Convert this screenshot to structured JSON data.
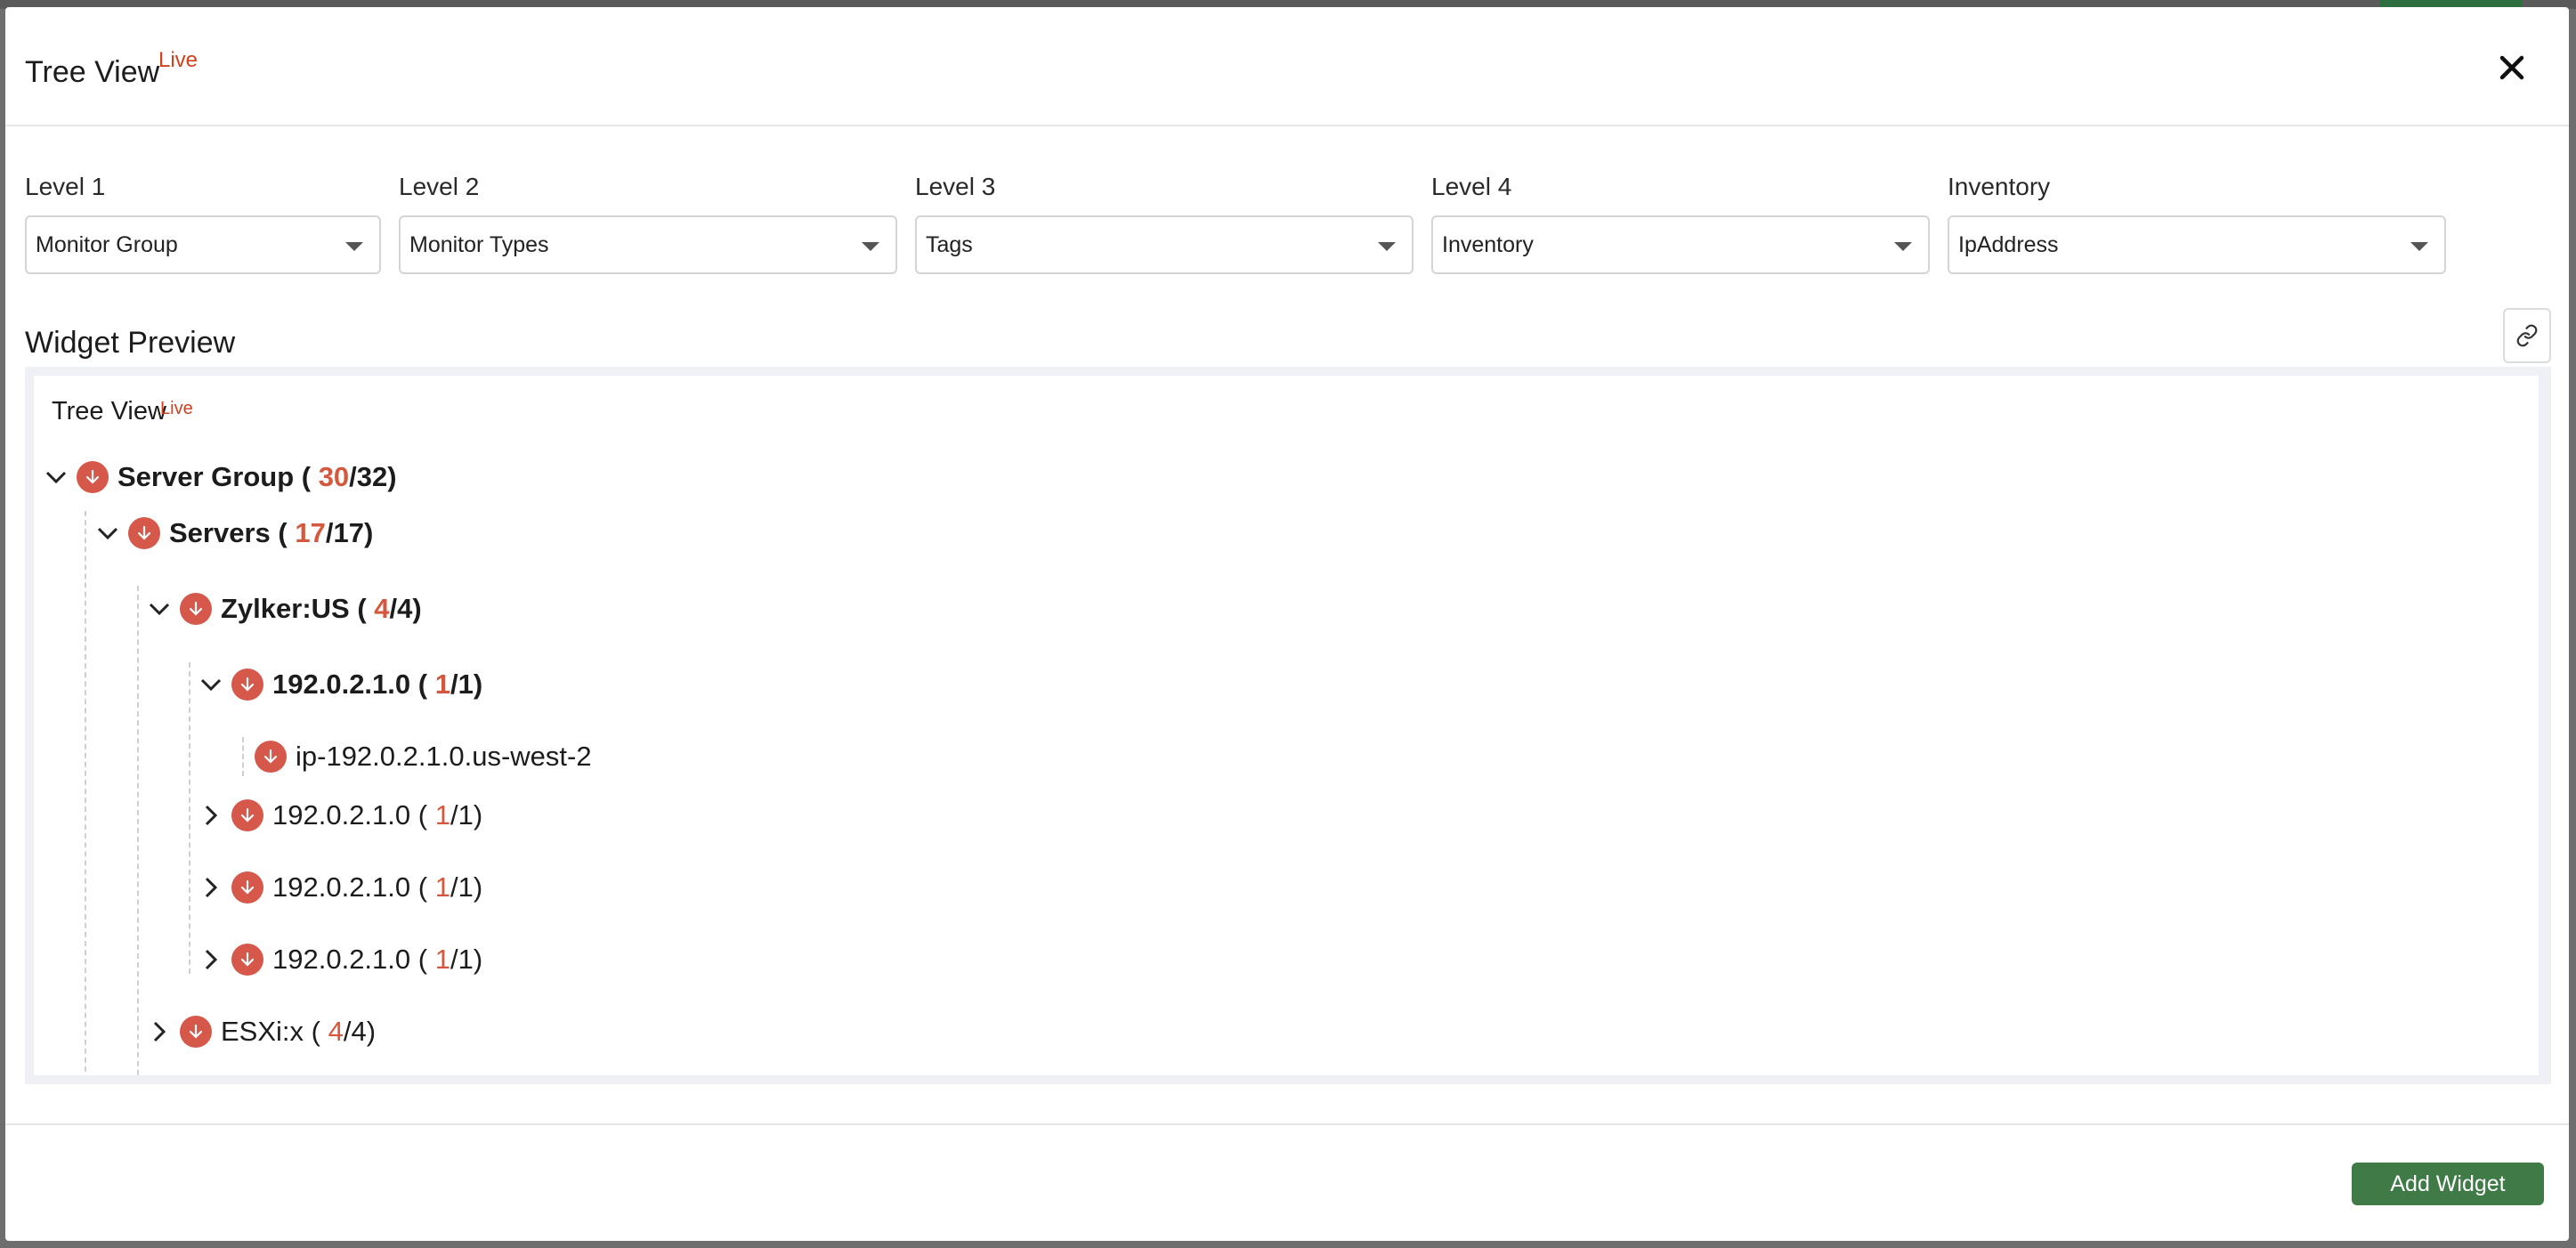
{
  "modal": {
    "title": "Tree View",
    "title_badge": "Live"
  },
  "levels": [
    {
      "label": "Level 1",
      "value": "Monitor Group"
    },
    {
      "label": "Level 2",
      "value": "Monitor Types"
    },
    {
      "label": "Level 3",
      "value": "Tags"
    },
    {
      "label": "Level 4",
      "value": "Inventory"
    },
    {
      "label": "Inventory",
      "value": "IpAddress"
    }
  ],
  "preview": {
    "section_title": "Widget Preview",
    "widget_title": "Tree View",
    "widget_badge": "Live"
  },
  "tree": [
    {
      "name": "Server Group",
      "up": "30",
      "total": "32",
      "expanded": true,
      "bold": true
    },
    {
      "name": "Servers",
      "up": "17",
      "total": "17",
      "expanded": true,
      "bold": true
    },
    {
      "name": "Zylker:US",
      "up": "4",
      "total": "4",
      "expanded": true,
      "bold": true
    },
    {
      "name": "192.0.2.1.0",
      "up": "1",
      "total": "1",
      "expanded": true,
      "bold": true
    },
    {
      "name": "ip-192.0.2.1.0.us-west-2"
    },
    {
      "name": "192.0.2.1.0",
      "up": "1",
      "total": "1",
      "expanded": false
    },
    {
      "name": "192.0.2.1.0",
      "up": "1",
      "total": "1",
      "expanded": false
    },
    {
      "name": "192.0.2.1.0",
      "up": "1",
      "total": "1",
      "expanded": false
    },
    {
      "name": "ESXi:x",
      "up": "4",
      "total": "4",
      "expanded": false
    }
  ],
  "footer": {
    "add_widget_label": "Add Widget"
  },
  "colors": {
    "status_down": "#d5584a",
    "up_count": "#d5583e",
    "live_badge": "#d0411c",
    "primary_button": "#3f7a47"
  },
  "icons": {
    "close": "close-icon",
    "caret": "caret-down-icon",
    "link": "link-icon",
    "expand": "chevron-right-icon",
    "collapse": "chevron-down-icon",
    "status": "arrow-down-icon"
  }
}
